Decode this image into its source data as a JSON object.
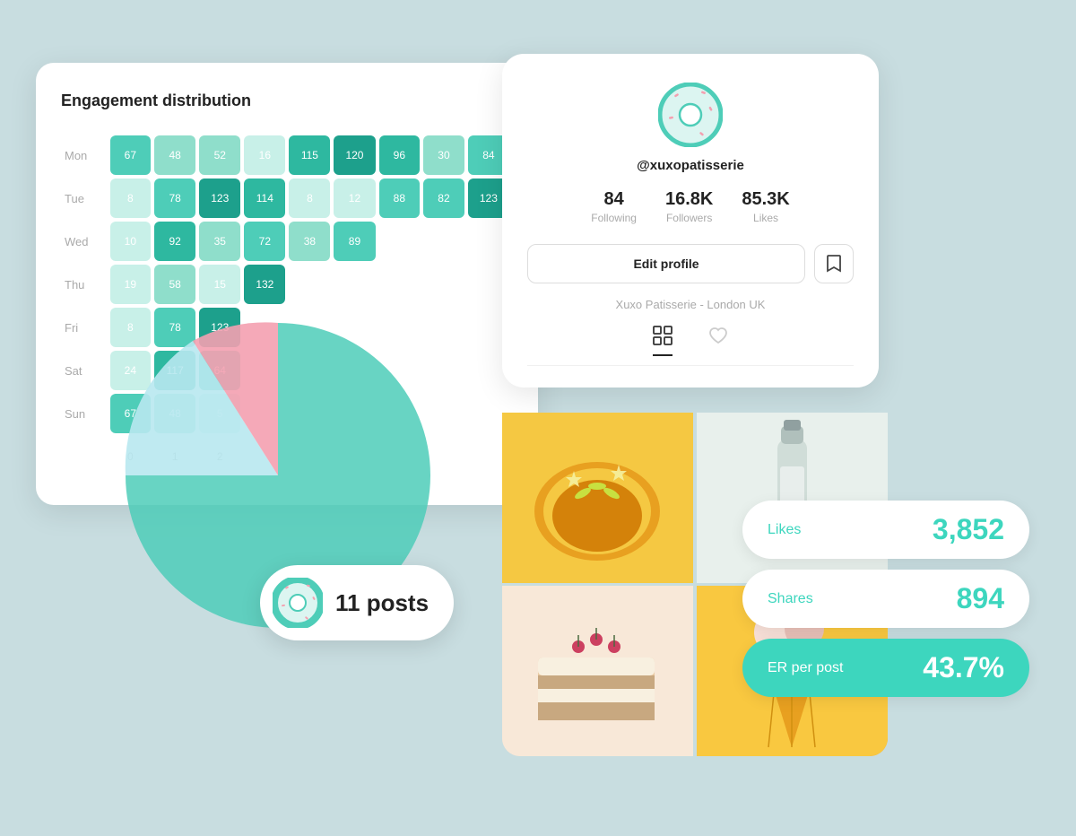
{
  "engagement": {
    "title": "Engagement distribution",
    "rows": [
      {
        "day": "Mon",
        "values": [
          67,
          48,
          52,
          16,
          115,
          120,
          96,
          30,
          84
        ]
      },
      {
        "day": "Tue",
        "values": [
          8,
          78,
          123,
          114,
          8,
          12,
          88,
          82,
          123
        ]
      },
      {
        "day": "Wed",
        "values": [
          10,
          92,
          35,
          72,
          38,
          89,
          null,
          null,
          null
        ]
      },
      {
        "day": "Thu",
        "values": [
          19,
          58,
          15,
          132,
          null,
          null,
          null,
          null,
          null
        ]
      },
      {
        "day": "Fri",
        "values": [
          8,
          78,
          123,
          null,
          null,
          null,
          null,
          null,
          null
        ]
      },
      {
        "day": "Sat",
        "values": [
          24,
          117,
          64,
          null,
          null,
          null,
          null,
          null,
          null
        ]
      },
      {
        "day": "Sun",
        "values": [
          67,
          48,
          5,
          null,
          null,
          null,
          null,
          null,
          null
        ]
      }
    ],
    "axis": [
      "0",
      "1",
      "2"
    ]
  },
  "profile": {
    "username": "@xuxopatisserie",
    "following": "84",
    "followers": "16.8K",
    "likes": "85.3K",
    "following_label": "Following",
    "followers_label": "Followers",
    "likes_label": "Likes",
    "edit_label": "Edit profile",
    "bio": "Xuxo Patisserie - London UK",
    "tab_grid": "|||",
    "tab_heart": "♡"
  },
  "posts_badge": {
    "text": "11 posts"
  },
  "stats": [
    {
      "label": "Likes",
      "value": "3,852",
      "teal": false
    },
    {
      "label": "Shares",
      "value": "894",
      "teal": false
    },
    {
      "label": "ER per post",
      "value": "43.7%",
      "teal": true
    }
  ]
}
